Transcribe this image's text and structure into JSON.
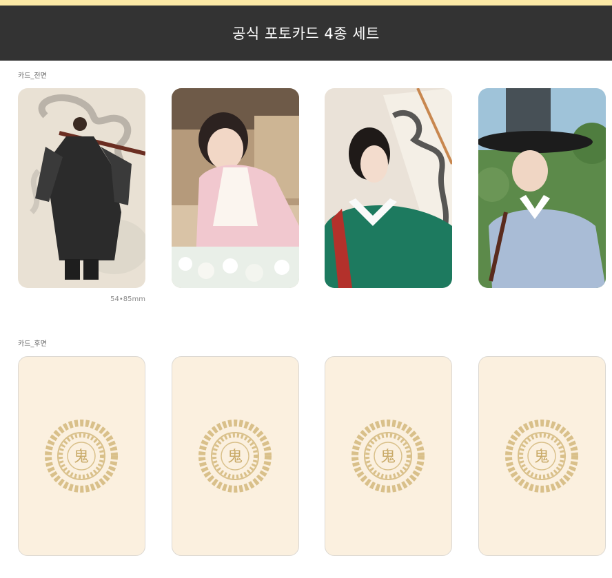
{
  "header": {
    "title": "공식 포토카드 4종 세트"
  },
  "front_section": {
    "label": "카드_전면",
    "size_note": "54•85mm"
  },
  "back_section": {
    "label": "카드_후면",
    "emblem_char": "鬼"
  },
  "colors": {
    "top_strip": "#fbe9a6",
    "header_bg": "#333333",
    "card_back": "#fbf0df",
    "emblem_gold": "#d9c08a"
  }
}
